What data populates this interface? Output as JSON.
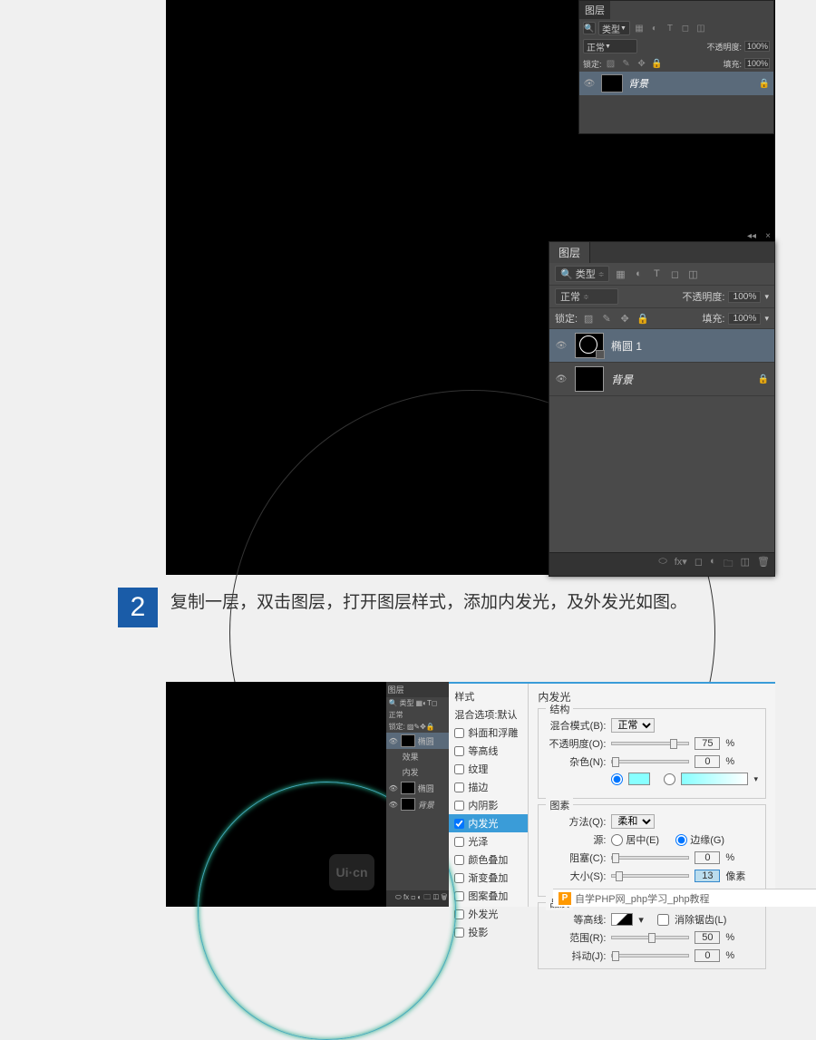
{
  "panel1": {
    "tab": "图层",
    "filterType": "类型",
    "blendMode": "正常",
    "opacityLabel": "不透明度:",
    "opacityVal": "100%",
    "lockLabel": "锁定:",
    "fillLabel": "填充:",
    "fillVal": "100%",
    "layer": "背景"
  },
  "panel2": {
    "tab": "图层",
    "filterType": "类型",
    "blendMode": "正常",
    "opacityLabel": "不透明度:",
    "opacityVal": "100%",
    "lockLabel": "锁定:",
    "fillLabel": "填充:",
    "fillVal": "100%",
    "layers": [
      "椭圆 1",
      "背景"
    ]
  },
  "step": {
    "num": "2",
    "text": "复制一层，双击图层，打开图层样式，添加内发光，及外发光如图。"
  },
  "watermark": "Ui·cn",
  "panel3": {
    "tab": "图层",
    "filterType": "类型",
    "blendMode": "正常",
    "lockLabel": "锁定:",
    "layers": [
      "椭圆",
      "效果",
      "内发",
      "椭圆",
      "背景"
    ]
  },
  "dlg": {
    "title": "内发光",
    "left": [
      "样式",
      "混合选项:默认",
      "斜面和浮雕",
      "等高线",
      "纹理",
      "描边",
      "内阴影",
      "内发光",
      "光泽",
      "颜色叠加",
      "渐变叠加",
      "图案叠加",
      "外发光",
      "投影"
    ],
    "grp1": "结构",
    "grp2": "图素",
    "grp3": "品质",
    "f": {
      "blendLabel": "混合模式(B):",
      "blendVal": "正常",
      "opacityLabel": "不透明度(O):",
      "opacityVal": "75",
      "noiseLabel": "杂色(N):",
      "noiseVal": "0",
      "methodLabel": "方法(Q):",
      "methodVal": "柔和",
      "sourceLabel": "源:",
      "srcCenter": "居中(E)",
      "srcEdge": "边缘(G)",
      "chokeLabel": "阻塞(C):",
      "chokeVal": "0",
      "sizeLabel": "大小(S):",
      "sizeVal": "13",
      "sizeUnit": "像素",
      "contourLabel": "等高线:",
      "antialias": "消除锯齿(L)",
      "rangeLabel": "范围(R):",
      "rangeVal": "50",
      "jitterLabel": "抖动(J):",
      "jitterVal": "0"
    }
  },
  "bottom": "自学PHP网_php学习_php教程"
}
